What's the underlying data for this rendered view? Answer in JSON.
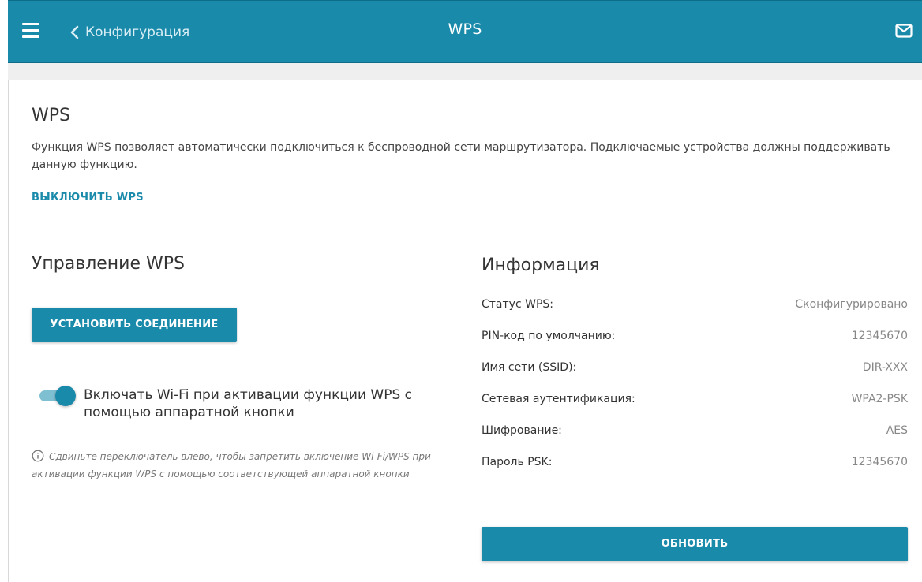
{
  "header": {
    "back_label": "Конфигурация",
    "title": "WPS",
    "accent_color": "#1a8aaa"
  },
  "wps": {
    "title": "WPS",
    "description": "Функция WPS позволяет автоматически подключиться к беспроводной сети маршрутизатора. Подключаемые устройства должны поддерживать данную функцию.",
    "disable_link": "ВЫКЛЮЧИТЬ WPS"
  },
  "management": {
    "title": "Управление WPS",
    "connect_button": "УСТАНОВИТЬ СОЕДИНЕНИЕ",
    "toggle": {
      "label": "Включать Wi-Fi при активации функции WPS с помощью аппаратной кнопки",
      "checked": true
    },
    "hint": "Сдвиньте переключатель влево, чтобы запретить включение Wi-Fi/WPS при активации функции WPS с помощью соответствующей аппаратной кнопки"
  },
  "info": {
    "title": "Информация",
    "rows": [
      {
        "key": "Статус WPS:",
        "value": "Сконфигурировано"
      },
      {
        "key": "PIN-код по умолчанию:",
        "value": "12345670"
      },
      {
        "key": "Имя сети (SSID):",
        "value": "DIR-XXX"
      },
      {
        "key": "Сетевая аутентификация:",
        "value": "WPA2-PSK"
      },
      {
        "key": "Шифрование:",
        "value": "AES"
      },
      {
        "key": "Пароль PSK:",
        "value": "12345670"
      }
    ],
    "refresh_button": "ОБНОВИТЬ"
  }
}
